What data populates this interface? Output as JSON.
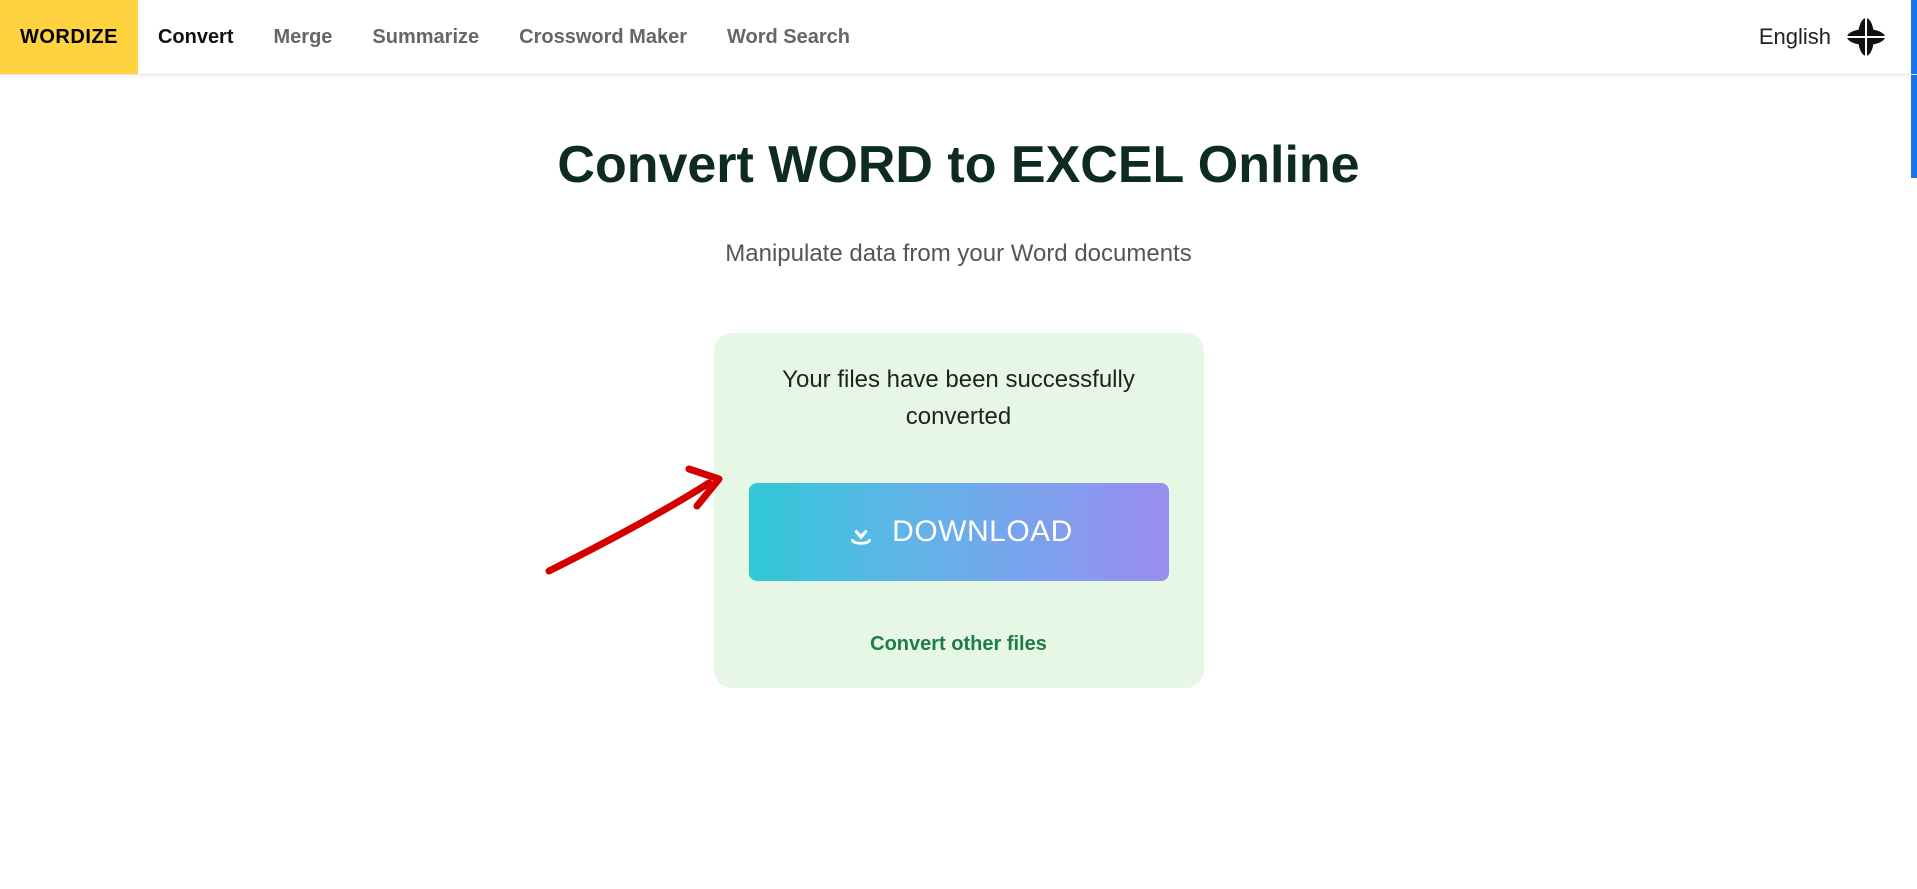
{
  "nav": {
    "logo": "WORDIZE",
    "items": [
      {
        "label": "Convert",
        "active": true
      },
      {
        "label": "Merge",
        "active": false
      },
      {
        "label": "Summarize",
        "active": false
      },
      {
        "label": "Crossword Maker",
        "active": false
      },
      {
        "label": "Word Search",
        "active": false
      }
    ],
    "language": "English"
  },
  "page": {
    "title": "Convert WORD to EXCEL Online",
    "subtitle": "Manipulate data from your Word documents"
  },
  "result": {
    "success_text": "Your files have been successfully converted",
    "download_label": "DOWNLOAD",
    "convert_other_label": "Convert other files"
  }
}
